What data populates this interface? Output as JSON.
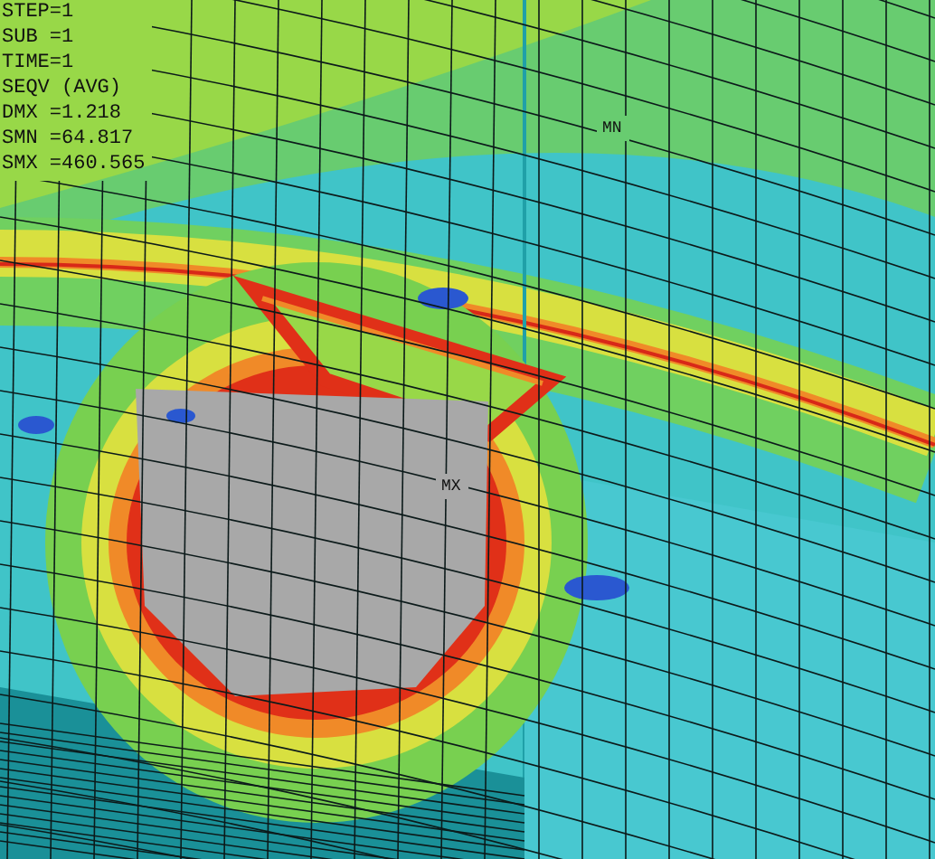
{
  "legend": [
    "STEP=1",
    "SUB =1",
    "TIME=1",
    "SEQV (AVG)",
    "DMX =1.218",
    "SMN =64.817",
    "SMX =460.565"
  ],
  "markers": [
    {
      "kind": "min",
      "label": "MN"
    },
    {
      "kind": "max",
      "label": "MX"
    }
  ]
}
